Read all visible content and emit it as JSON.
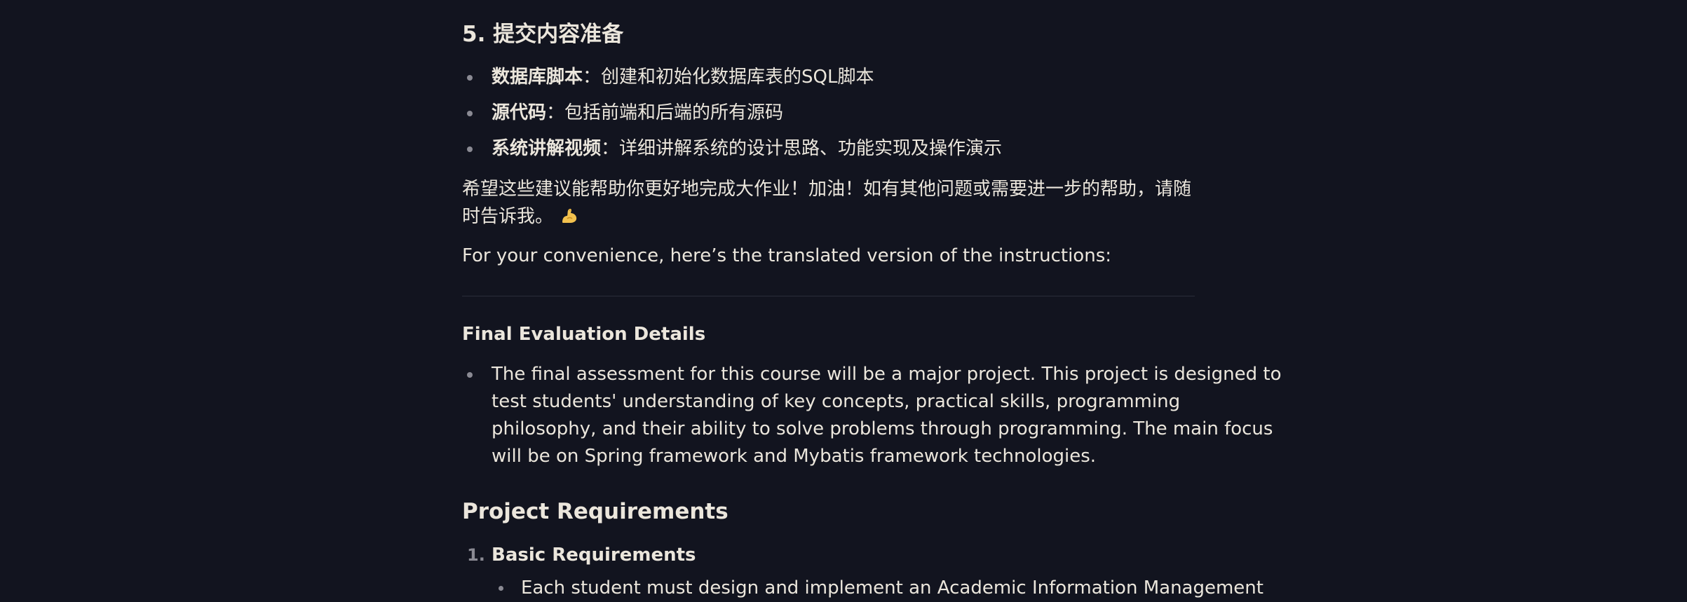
{
  "section5": {
    "title": "5. 提交内容准备",
    "items": [
      {
        "label": "数据库脚本",
        "text": "：创建和初始化数据库表的SQL脚本"
      },
      {
        "label": "源代码",
        "text": "：包括前端和后端的所有源码"
      },
      {
        "label": "系统讲解视频",
        "text": "：详细讲解系统的设计思路、功能实现及操作演示"
      }
    ],
    "closing_line1": "希望这些建议能帮助你更好地完成大作业！加油！如有其他问题或需要进一步的帮助，请随",
    "closing_line2": "时告诉我。",
    "emoji": "flexed-biceps-icon"
  },
  "translation_intro": "For your convenience, here’s the translated version of the instructions:",
  "final_eval": {
    "title": "Final Evaluation Details",
    "item_lines": [
      "The final assessment for this course will be a major project. This project is designed to",
      "test students' understanding of key concepts, practical skills, programming",
      "philosophy, and their ability to solve problems through programming. The main focus",
      "will be on Spring framework and Mybatis framework technologies."
    ]
  },
  "project_requirements": {
    "title": "Project Requirements",
    "list": [
      {
        "number": "1.",
        "label": "Basic Requirements",
        "sub_items": [
          "Each student must design and implement an Academic Information Management"
        ]
      }
    ]
  },
  "colors": {
    "background": "#12141f",
    "text": "#ebe6dc",
    "marker": "#8a8a93",
    "divider": "#2a2d3a",
    "emoji": "#f2c14e"
  }
}
